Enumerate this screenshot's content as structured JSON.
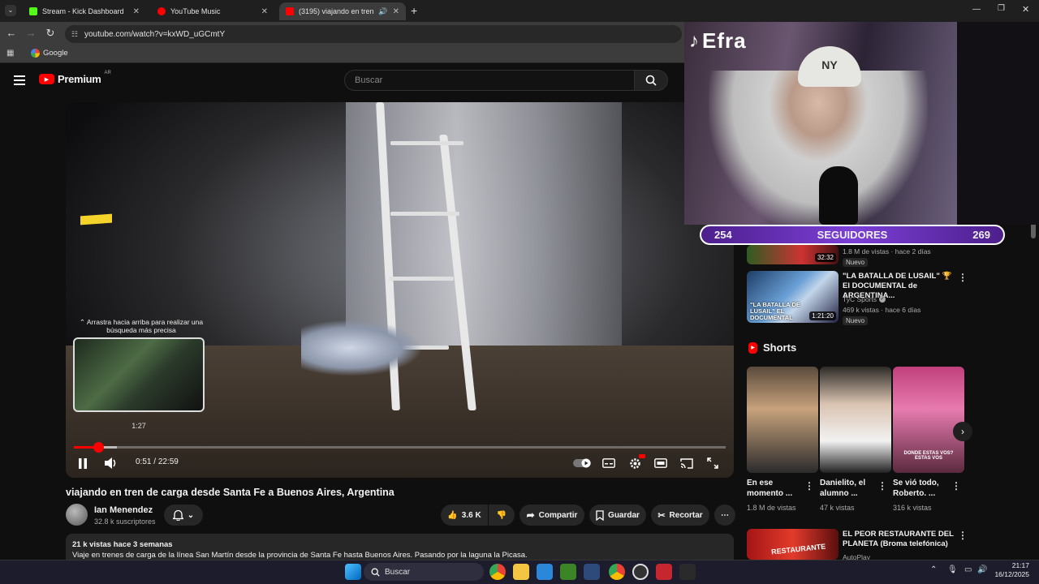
{
  "tabs": [
    {
      "label": "Stream - Kick Dashboard",
      "color": "#53fc18"
    },
    {
      "label": "YouTube Music",
      "color": "#ff0000"
    },
    {
      "label": "(3195) viajando en tren de ...",
      "color": "#ff0000"
    }
  ],
  "address_bar": {
    "url": "youtube.com/watch?v=kxWD_uGCmtY"
  },
  "bookmarks": [
    {
      "label": "Google"
    }
  ],
  "yt_header": {
    "logo": "Premium",
    "region": "AR",
    "search_placeholder": "Buscar"
  },
  "player": {
    "preview_tip": "⌃ Arrastra hacia arriba para realizar una búsqueda más precisa",
    "preview_time": "1:27",
    "current_time": "0:51",
    "duration": "22:59",
    "played_fraction": 0.037,
    "buffered_fraction": 0.066
  },
  "video": {
    "title": "viajando en tren de carga desde Santa Fe a Buenos Aires, Argentina",
    "channel": "Ian Menendez",
    "subscribers": "32.8 k suscriptores",
    "likes": "3.6 K",
    "share": "Compartir",
    "save": "Guardar",
    "clip": "Recortar",
    "views": "21 k vistas  hace 3 semanas",
    "description": "Viaje en trenes de carga de la línea San Martín desde la provincia de Santa Fe hasta Buenos Aires. Pasando por la laguna la Picasa."
  },
  "recommendations": [
    {
      "meta": "1.8 M de vistas · hace 2 días",
      "duration": "32:32",
      "badge": "Nuevo"
    },
    {
      "title": "\"LA BATALLA DE LUSAIL\" 🏆 El DOCUMENTAL de ARGENTINA...",
      "channel": "TyC Sports",
      "meta": "469 k vistas · hace 6 días",
      "duration": "1:21:20",
      "badge": "Nuevo",
      "thumb_text": "\"LA BATALLA DE LUSAIL\" EL DOCUMENTAL"
    },
    {
      "title": "EL PEOR RESTAURANTE DEL PLANETA (Broma telefónica)",
      "channel": "AutoPlay",
      "thumb_text": "RESTAURANTE"
    }
  ],
  "shorts": {
    "heading": "Shorts",
    "items": [
      {
        "title": "En ese momento ...",
        "views": "1.8 M de vistas"
      },
      {
        "title": "Danielito, el alumno ...",
        "views": "47 k vistas"
      },
      {
        "title": "Se vió todo, Roberto. ...",
        "views": "316 k vistas",
        "overlay": "DONDE ESTAS VOS? ESTAS VOS"
      }
    ]
  },
  "overlay": {
    "watermark": "Efra",
    "followers_left": "254",
    "followers_label": "SEGUIDORES",
    "followers_right": "269"
  },
  "taskbar": {
    "search": "Buscar",
    "time": "21:17",
    "date": "16/12/2025"
  }
}
